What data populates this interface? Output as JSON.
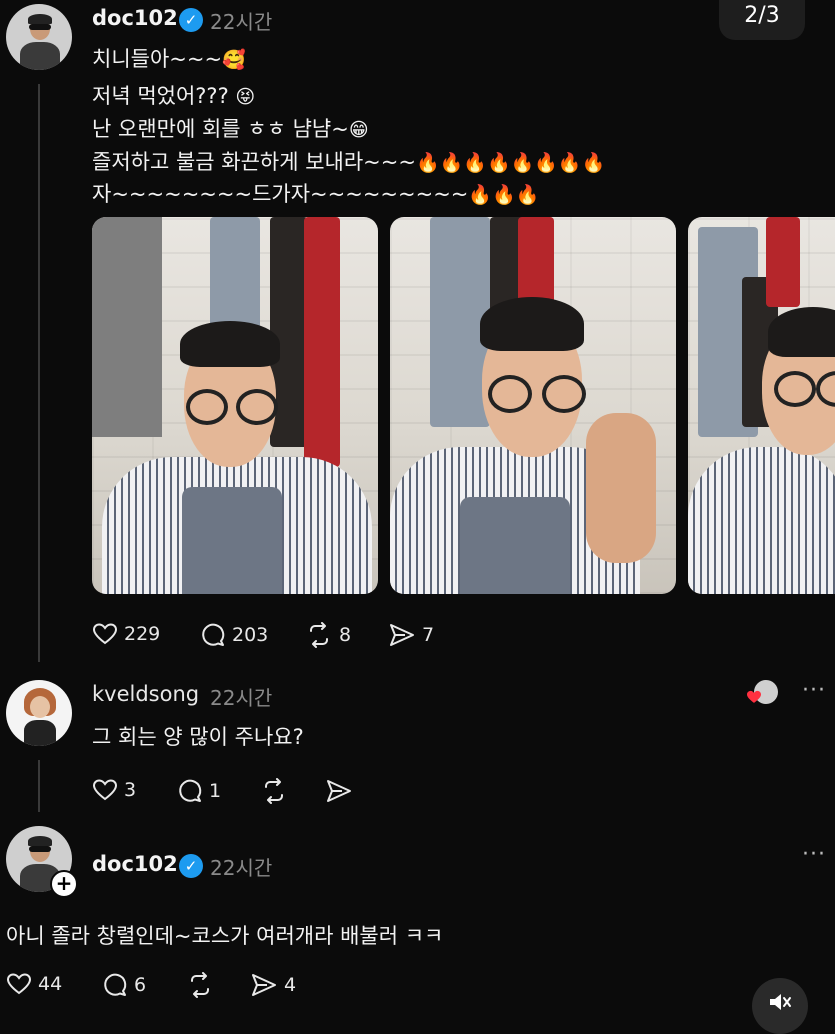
{
  "page_indicator": "2/3",
  "post": {
    "username": "doc102",
    "time": "22시간",
    "lines": [
      {
        "text": "치니들아~~~",
        "emoji": "🥰"
      },
      {
        "text": "저녁 먹었어??? ",
        "emoji": "😝"
      },
      {
        "text": "난 오랜만에 회를 ㅎㅎ 냠냠~",
        "emoji": "😁"
      },
      {
        "text": "즐저하고 불금 화끈하게 보내라~~~",
        "emoji": "🔥🔥🔥🔥🔥🔥🔥🔥"
      },
      {
        "text": "자~~~~~~~~드가자~~~~~~~~~",
        "emoji": "🔥🔥🔥"
      }
    ],
    "actions": {
      "likes": "229",
      "comments": "203",
      "reposts": "8",
      "shares": "7"
    }
  },
  "reply": {
    "username": "kveldsong",
    "time": "22시간",
    "text": "그 회는 양 많이 주나요?",
    "actions": {
      "likes": "3",
      "comments": "1"
    }
  },
  "reply2": {
    "username": "doc102",
    "time": "22시간",
    "text": "아니 졸라 창렬인데~코스가 여러개라 배불러 ㅋㅋ",
    "actions": {
      "likes": "44",
      "comments": "6",
      "shares": "4"
    }
  },
  "icons": {
    "more": "more-icon",
    "verified": "verified-icon",
    "heart": "heart-icon",
    "comment": "comment-icon",
    "repost": "repost-icon",
    "share": "share-icon",
    "mute": "mute-icon"
  },
  "colors": {
    "background": "#0b0b0b",
    "verified": "#1d9bf0",
    "muted_text": "#8a8a8a"
  }
}
